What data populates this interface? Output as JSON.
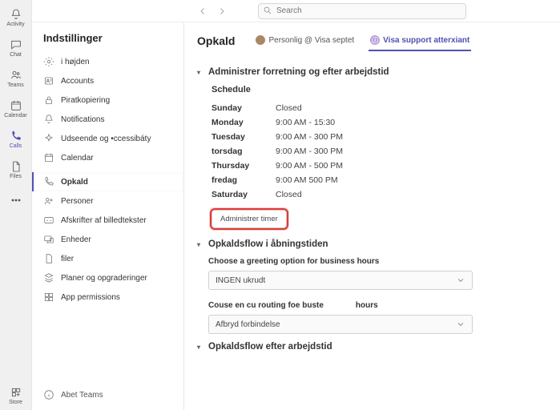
{
  "search": {
    "placeholder": "Search"
  },
  "rail": {
    "items": [
      {
        "id": "activity",
        "label": "Activity"
      },
      {
        "id": "chat",
        "label": "Chat"
      },
      {
        "id": "teams",
        "label": "Teams"
      },
      {
        "id": "calendar",
        "label": "Calendar"
      },
      {
        "id": "calls",
        "label": "Calls"
      },
      {
        "id": "files",
        "label": "Files"
      }
    ],
    "store": "Store"
  },
  "settings_title": "Indstillinger",
  "settings_nav": [
    {
      "id": "hojden",
      "label": "i højden"
    },
    {
      "id": "accounts",
      "label": "Accounts"
    },
    {
      "id": "piracy",
      "label": "Piratkopiering"
    },
    {
      "id": "notifications",
      "label": "Notifications"
    },
    {
      "id": "appearance",
      "label": "Udseende og •ccessibáty"
    },
    {
      "id": "calendar",
      "label": "Calendar"
    },
    {
      "id": "opkald",
      "label": "Opkald"
    },
    {
      "id": "personer",
      "label": "Personer"
    },
    {
      "id": "captions",
      "label": "Afskrifter af billedtekster"
    },
    {
      "id": "devices",
      "label": "Enheder"
    },
    {
      "id": "filer",
      "label": "filer"
    },
    {
      "id": "plans",
      "label": "Planer og opgraderinger"
    },
    {
      "id": "appperm",
      "label": "App  permissions"
    }
  ],
  "about": "Abet Teams",
  "page": {
    "title": "Opkald",
    "tabs": [
      {
        "id": "t1",
        "label": "Personlig @ Visa septet"
      },
      {
        "id": "t2",
        "label": "Visa support atterxiant"
      }
    ]
  },
  "section1": {
    "title": "Administrer forretning og efter arbejdstid",
    "schedule_label": "Schedule",
    "rows": [
      {
        "day": "Sunday",
        "value": "Closed"
      },
      {
        "day": "Monday",
        "value": "9:00 AM - 15:30"
      },
      {
        "day": "Tuesday",
        "value": "9:00 AM - 300 PM"
      },
      {
        "day": "torsdag",
        "value": "9:00 AM - 300 PM"
      },
      {
        "day": "Thursday",
        "value": "9:00 AM - 500 PM"
      },
      {
        "day": "fredag",
        "value": "9:00 AM 500 PM"
      },
      {
        "day": "Saturday",
        "value": "Closed"
      }
    ],
    "manage_btn": "Administrer timer"
  },
  "section2": {
    "title": "Opkaldsflow i åbningstiden",
    "greeting_label": "Choose a greeting option for business hours",
    "greeting_value": "INGEN ukrudt",
    "routing_label": "Couse en cu routing foe buste",
    "hours_label": "hours",
    "routing_value": "Afbryd forbindelse"
  },
  "section3": {
    "title": "Opkaldsflow efter arbejdstid"
  },
  "active_nav": "opkald",
  "active_tab": "t2",
  "active_rail": "calls"
}
